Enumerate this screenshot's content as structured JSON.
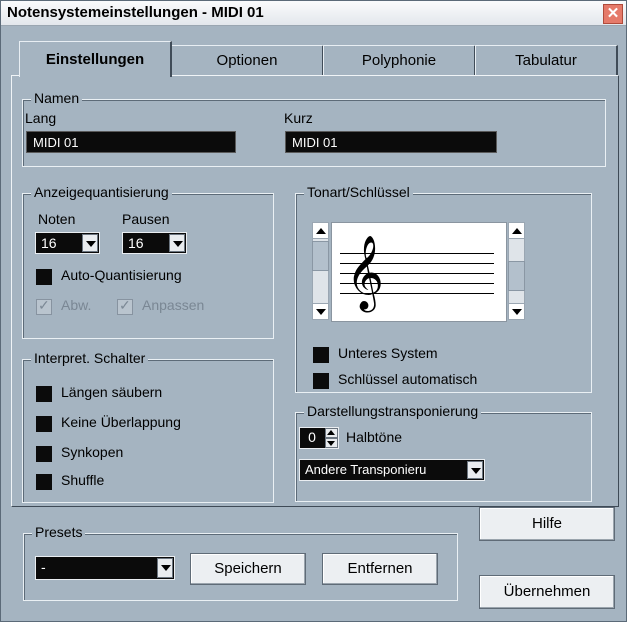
{
  "window": {
    "title": "Notensystemeinstellungen - MIDI 01"
  },
  "tabs": [
    {
      "label": "Einstellungen",
      "active": true
    },
    {
      "label": "Optionen"
    },
    {
      "label": "Polyphonie"
    },
    {
      "label": "Tabulatur"
    }
  ],
  "namen": {
    "legend": "Namen",
    "lang_label": "Lang",
    "lang_value": "MIDI 01",
    "kurz_label": "Kurz",
    "kurz_value": "MIDI 01"
  },
  "anzeige": {
    "legend": "Anzeigequantisierung",
    "noten_label": "Noten",
    "noten_value": "16",
    "pausen_label": "Pausen",
    "pausen_value": "16",
    "auto_label": "Auto-Quantisierung",
    "abw_label": "Abw.",
    "anpassen_label": "Anpassen"
  },
  "interpret": {
    "legend": "Interpret. Schalter",
    "items": [
      "Längen säubern",
      "Keine Überlappung",
      "Synkopen",
      "Shuffle"
    ]
  },
  "tonart": {
    "legend": "Tonart/Schlüssel",
    "clef_symbol": "𝄞",
    "unteres_label": "Unteres System",
    "schluessel_label": "Schlüssel automatisch"
  },
  "transpose": {
    "legend": "Darstellungstransponierung",
    "value": "0",
    "unit_label": "Halbtöne",
    "dropdown_value": "Andere Transponieru"
  },
  "presets": {
    "legend": "Presets",
    "value": "-",
    "save_label": "Speichern",
    "remove_label": "Entfernen"
  },
  "buttons": {
    "help_label": "Hilfe",
    "apply_label": "Übernehmen"
  },
  "colors": {
    "dialog_bg": "#a5b4c1",
    "field_bg": "#0b0b0b",
    "close_red": "#e57a6a"
  }
}
